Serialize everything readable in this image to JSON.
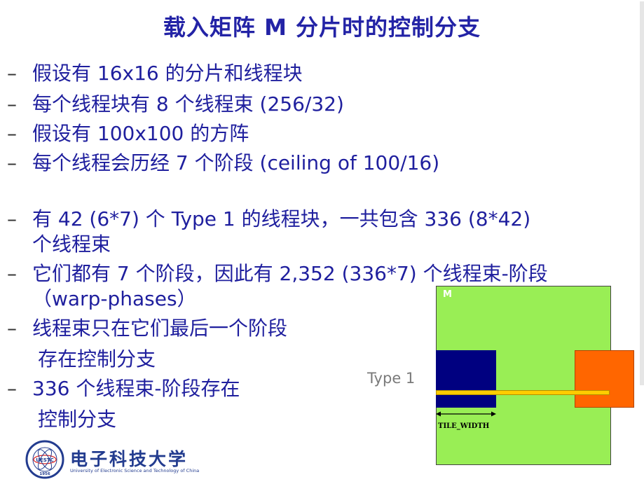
{
  "slide": {
    "title": "载入矩阵 M 分片时的控制分支"
  },
  "bullets": [
    {
      "dash": "–",
      "text": "假设有 16x16 的分片和线程块"
    },
    {
      "dash": "–",
      "text": "每个线程块有 8 个线程束 (256/32)"
    },
    {
      "dash": "–",
      "text": "假设有 100x100 的方阵"
    },
    {
      "dash": "–",
      "text": "每个线程会历经 7 个阶段 (ceiling of 100/16)"
    },
    {
      "dash": "–",
      "text": "有 42 (6*7) 个 Type 1 的线程块，一共包含 336 (8*42)",
      "cont": "个线程束"
    },
    {
      "dash": "–",
      "text": "它们都有 7 个阶段，因此有 2,352 (336*7) 个线程束-阶段",
      "cont": "（warp-phases）"
    },
    {
      "dash": "–",
      "text": "线程束只在它们最后一个阶段",
      "cont": "存在控制分支"
    },
    {
      "dash": "–",
      "text": "336 个线程束-阶段存在",
      "cont": "控制分支"
    }
  ],
  "diagram": {
    "matrix_label": "M",
    "type_label": "Type 1",
    "tile_width_label": "TILE_WIDTH",
    "colors": {
      "matrix": "#99ee55",
      "loaded_tile": "#000080",
      "boundary_tile": "#ff6600",
      "thread_row": "#ffcc00"
    }
  },
  "logo": {
    "name": "电子科技大学",
    "subtitle": "University of Electronic Science and Technology of China",
    "seal_text": "UESTC",
    "seal_year": "1956"
  }
}
